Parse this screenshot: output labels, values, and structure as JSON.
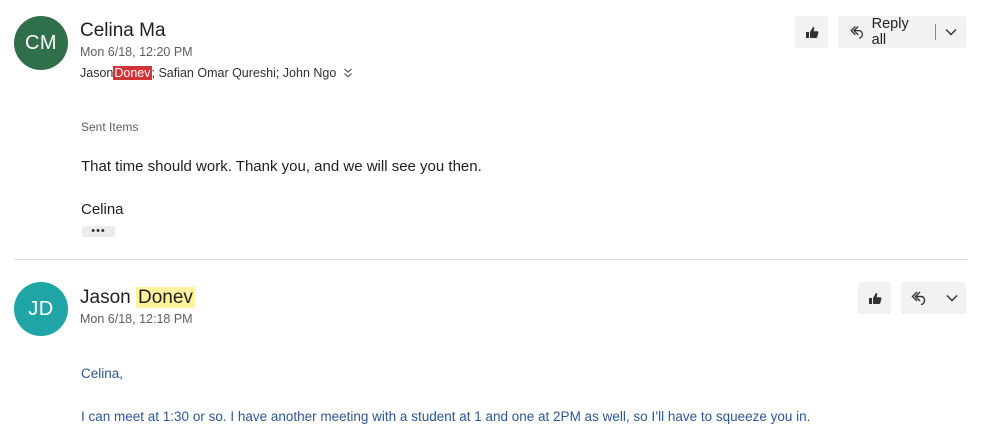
{
  "message1": {
    "avatar_initials": "CM",
    "sender": "Celina Ma",
    "date": "Mon 6/18, 12:20 PM",
    "recipients": {
      "r1_first": "Jason ",
      "r1_highlight": "Donev",
      "rest": "; Safian Omar Qureshi; John Ngo"
    },
    "reply_all_label": "Reply all",
    "folder": "Sent Items",
    "body_line": "That time should work. Thank you, and we will see you then.",
    "signature": "Celina",
    "ellipsis": "•••"
  },
  "message2": {
    "avatar_initials": "JD",
    "sender_first": "Jason ",
    "sender_highlight": "Donev",
    "date": "Mon 6/18, 12:18 PM",
    "greeting": "Celina,",
    "body_line": "I can meet at 1:30 or so. I have another meeting with a student at 1 and one at 2PM as well, so I’ll have to squeeze you in."
  },
  "colors": {
    "avatar_cm": "#2f6f4a",
    "avatar_jd": "#20a5a7",
    "highlight_red": "#d13438",
    "highlight_yellow": "#fff3a0",
    "quoted_text": "#2b5797"
  }
}
